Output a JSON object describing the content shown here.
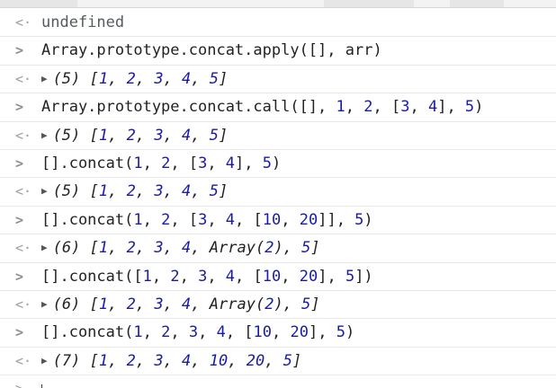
{
  "console": {
    "first_output": "undefined",
    "entries": [
      {
        "input": "Array.prototype.concat.apply([], arr)",
        "output_count": "(5)",
        "output_body": "[1, 2, 3, 4, 5]"
      },
      {
        "input": "Array.prototype.concat.call([], 1, 2, [3, 4], 5)",
        "output_count": "(5)",
        "output_body": "[1, 2, 3, 4, 5]"
      },
      {
        "input": "[].concat(1, 2, [3, 4], 5)",
        "output_count": "(5)",
        "output_body": "[1, 2, 3, 4, 5]"
      },
      {
        "input": "[].concat(1, 2, [3, 4, [10, 20]], 5)",
        "output_count": "(6)",
        "output_body": "[1, 2, 3, 4, Array(2), 5]"
      },
      {
        "input": "[].concat([1, 2, 3, 4, [10, 20], 5])",
        "output_count": "(6)",
        "output_body": "[1, 2, 3, 4, Array(2), 5]"
      },
      {
        "input": "[].concat(1, 2, 3, 4, [10, 20], 5)",
        "output_count": "(7)",
        "output_body": "[1, 2, 3, 4, 10, 20, 5]"
      }
    ]
  },
  "icons": {
    "input_prompt": ">",
    "output_prompt": "<·",
    "expand_triangle": "▶"
  },
  "colors": {
    "number": "#1a1aa6",
    "prompt": "#8a8f96",
    "row_divider": "#e8e8e8"
  }
}
